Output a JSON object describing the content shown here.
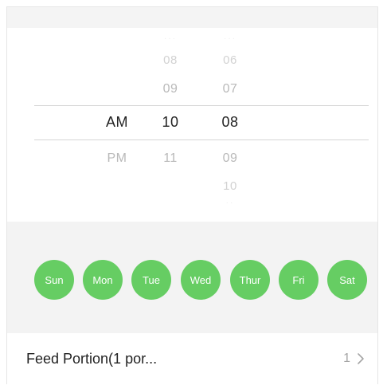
{
  "picker": {
    "ampm": {
      "above": "",
      "selected": "AM",
      "below": "PM"
    },
    "hour": {
      "faint_top": "···",
      "above2": "08",
      "above1": "09",
      "selected": "10",
      "below1": "11"
    },
    "minute": {
      "faint_top": "···",
      "above2": "06",
      "above1": "07",
      "selected": "08",
      "below1": "09",
      "below2": "10",
      "faint_bottom": "··"
    }
  },
  "days": [
    {
      "label": "Sun",
      "selected": true
    },
    {
      "label": "Mon",
      "selected": true
    },
    {
      "label": "Tue",
      "selected": true
    },
    {
      "label": "Wed",
      "selected": true
    },
    {
      "label": "Thur",
      "selected": true
    },
    {
      "label": "Fri",
      "selected": true
    },
    {
      "label": "Sat",
      "selected": true
    }
  ],
  "feed": {
    "label": "Feed Portion(1 por...",
    "value": "1"
  },
  "colors": {
    "accent_green": "#66cd63",
    "selected_text": "#222222",
    "unselected_text": "#b9b9b9"
  },
  "icons": {
    "chevron": "chevron-right-icon"
  }
}
